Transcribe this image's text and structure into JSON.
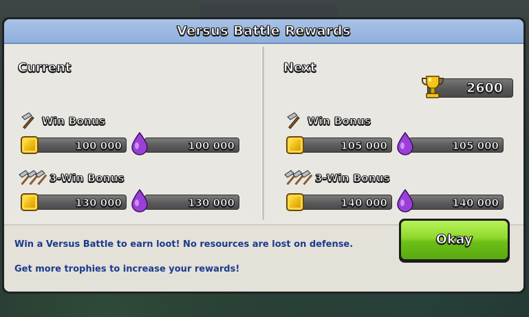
{
  "dialog": {
    "title": "Versus Battle Rewards"
  },
  "current": {
    "heading": "Current",
    "win_bonus": {
      "label": "Win Bonus",
      "gold": "100 000",
      "elixir": "100 000"
    },
    "three_win_bonus": {
      "label": "3-Win Bonus",
      "gold": "130 000",
      "elixir": "130 000"
    }
  },
  "next": {
    "heading": "Next",
    "trophies": "2600",
    "win_bonus": {
      "label": "Win Bonus",
      "gold": "105 000",
      "elixir": "105 000"
    },
    "three_win_bonus": {
      "label": "3-Win Bonus",
      "gold": "140 000",
      "elixir": "140 000"
    }
  },
  "footer": {
    "info_line_1": "Win a Versus Battle to earn loot! No resources are lost on defense.",
    "info_line_2": "Get more trophies to increase your rewards!",
    "okay_label": "Okay"
  },
  "icons": {
    "gold": "gold-coin-icon",
    "elixir": "elixir-drop-icon",
    "hammer": "hammer-icon",
    "trophy": "trophy-icon"
  },
  "colors": {
    "title_bar": "#8fb0dd",
    "okay_button": "#7ccb22",
    "info_text": "#1b3a8c",
    "panel_bg": "#e9e7e1"
  }
}
